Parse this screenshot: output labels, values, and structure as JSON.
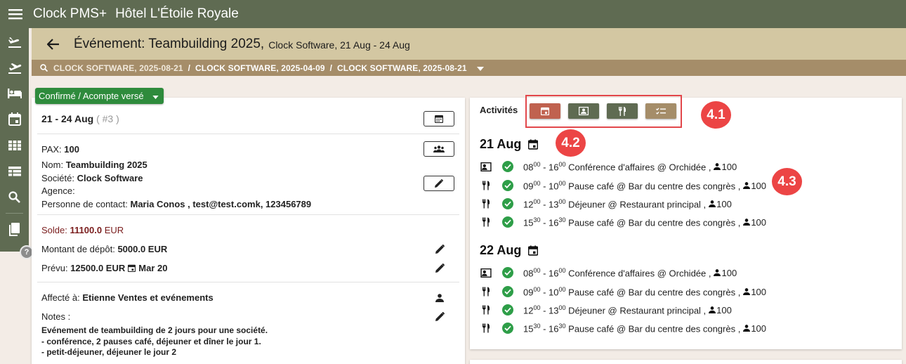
{
  "app": {
    "name": "Clock PMS+",
    "hotel": "Hôtel L'Étoile Royale"
  },
  "header": {
    "event_label": "Événement:",
    "event_name": "Teambuilding 2025,",
    "event_sub": "Clock Software, 21 Aug - 24 Aug"
  },
  "breadcrumb": [
    "CLOCK SOFTWARE, 2025-08-21",
    "CLOCK SOFTWARE, 2025-04-09",
    "CLOCK SOFTWARE, 2025-08-21"
  ],
  "status": {
    "label": "Confirmé / Acompte versé"
  },
  "details": {
    "dates": "21 - 24 Aug",
    "dates_count": "( #3 )",
    "pax_label": "PAX:",
    "pax_value": "100",
    "nom_label": "Nom:",
    "nom_value": "Teambuilding 2025",
    "societe_label": "Société:",
    "societe_value": "Clock Software",
    "agence_label": "Agence:",
    "contact_label": "Personne de contact:",
    "contact_value": "Maria Conos , test@test.comk, 123456789",
    "solde_label": "Solde:",
    "solde_value": "11100.0",
    "solde_currency": "EUR",
    "depot_label": "Montant de dépôt:",
    "depot_value": "5000.0 EUR",
    "prevu_label": "Prévu:",
    "prevu_value": "12500.0 EUR",
    "prevu_date": "Mar 20",
    "affecte_label": "Affecté à:",
    "affecte_value": "Etienne  Ventes et evénements",
    "notes_label": "Notes :",
    "notes_line1": "Evénement de teambuilding de 2 jours pour une société.",
    "notes_line2": "- conférence, 2 pauses café, déjeuner et dîner le jour 1.",
    "notes_line3": "- petit-déjeuner, déjeuner le jour 2"
  },
  "activities": {
    "title": "Activités",
    "buttons": [
      {
        "icon": "calendar-icon",
        "color": "#c0624f"
      },
      {
        "icon": "contact-card-icon",
        "color": "#5f6b52"
      },
      {
        "icon": "restaurant-icon",
        "color": "#5f6b52"
      },
      {
        "icon": "checklist-icon",
        "color": "#a58d69"
      }
    ],
    "days": [
      {
        "date": "21 Aug",
        "items": [
          {
            "type": "conference",
            "start_h": "08",
            "start_m": "00",
            "end_h": "16",
            "end_m": "00",
            "desc": "Conférence d'affaires @ Orchidée ,",
            "pax": "100"
          },
          {
            "type": "restaurant",
            "start_h": "09",
            "start_m": "00",
            "end_h": "10",
            "end_m": "00",
            "desc": "Pause café @ Bar du centre des congrès ,",
            "pax": "100"
          },
          {
            "type": "restaurant",
            "start_h": "12",
            "start_m": "00",
            "end_h": "13",
            "end_m": "00",
            "desc": "Déjeuner @ Restaurant principal ,",
            "pax": "100"
          },
          {
            "type": "restaurant",
            "start_h": "15",
            "start_m": "30",
            "end_h": "16",
            "end_m": "30",
            "desc": "Pause café @ Bar du centre des congrès ,",
            "pax": "100"
          }
        ]
      },
      {
        "date": "22 Aug",
        "items": [
          {
            "type": "conference",
            "start_h": "08",
            "start_m": "00",
            "end_h": "16",
            "end_m": "00",
            "desc": "Conférence d'affaires @ Orchidée ,",
            "pax": "100"
          },
          {
            "type": "restaurant",
            "start_h": "09",
            "start_m": "00",
            "end_h": "10",
            "end_m": "00",
            "desc": "Pause café @ Bar du centre des congrès ,",
            "pax": "100"
          },
          {
            "type": "restaurant",
            "start_h": "12",
            "start_m": "00",
            "end_h": "13",
            "end_m": "00",
            "desc": "Déjeuner @ Restaurant principal ,",
            "pax": "100"
          },
          {
            "type": "restaurant",
            "start_h": "15",
            "start_m": "30",
            "end_h": "16",
            "end_m": "30",
            "desc": "Pause café @ Bar du centre des congrès ,",
            "pax": "100"
          }
        ]
      }
    ]
  },
  "annotations": {
    "a1": "4.1",
    "a2": "4.2",
    "a3": "4.3"
  },
  "help": {
    "label": "?"
  },
  "colors": {
    "primary": "#5f6b52",
    "header": "#d3c7a2",
    "breadcrumb": "#a58d69",
    "status": "#2e8b3c",
    "annotation": "#ec4545"
  }
}
